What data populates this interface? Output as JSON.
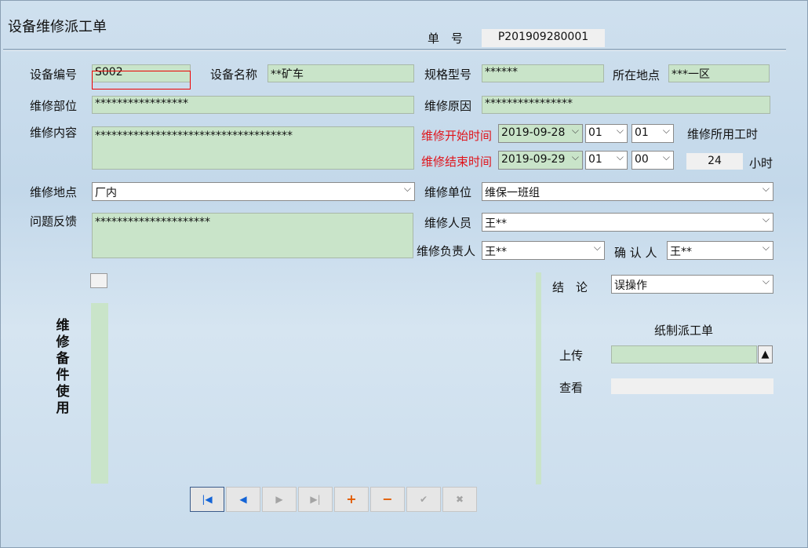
{
  "form": {
    "title": "设备维修派工单",
    "order_no_label": "单　号",
    "order_no": "P201909280001"
  },
  "labels": {
    "device_code": "设备编号",
    "device_name": "设备名称",
    "spec": "规格型号",
    "location": "所在地点",
    "part": "维修部位",
    "reason": "维修原因",
    "content": "维修内容",
    "start_time": "维修开始时间",
    "end_time": "维修结束时间",
    "hours_title": "维修所用工时",
    "hours_unit": "小时",
    "place": "维修地点",
    "unit": "维修单位",
    "feedback": "问题反馈",
    "staff": "维修人员",
    "leader": "维修负责人",
    "confirm": "确 认 人",
    "conclusion": "结　论",
    "parts_usage": "维修备件使用",
    "paper_order": "纸制派工单",
    "upload": "上传",
    "view": "查看"
  },
  "values": {
    "device_code": "S002",
    "device_name": "**矿车",
    "spec": "******",
    "location": "***一区",
    "part": "*****************",
    "reason": "****************",
    "content": "************************************",
    "start_date": "2019-09-28",
    "start_hour": "01",
    "start_min": "01",
    "end_date": "2019-09-29",
    "end_hour": "01",
    "end_min": "00",
    "hours": "24",
    "place": "厂内",
    "unit": "维保一班组",
    "feedback": "*********************",
    "staff": "王**",
    "leader": "王**",
    "confirm": "王**",
    "conclusion": "误操作",
    "upload_path": "",
    "view_path": ""
  },
  "icons": {
    "dropdown": "chevron-down-icon",
    "upload": "up-triangle-icon"
  },
  "nav": {
    "first": "|◀",
    "prev": "◀",
    "next": "▶",
    "last": "▶|",
    "add": "+",
    "delete": "−",
    "save": "✔",
    "cancel": "✖"
  },
  "colors": {
    "field_green": "#c9e4c9",
    "required_red": "#e0141b",
    "nav_blue": "#1464d6",
    "nav_orange": "#e25a00"
  }
}
